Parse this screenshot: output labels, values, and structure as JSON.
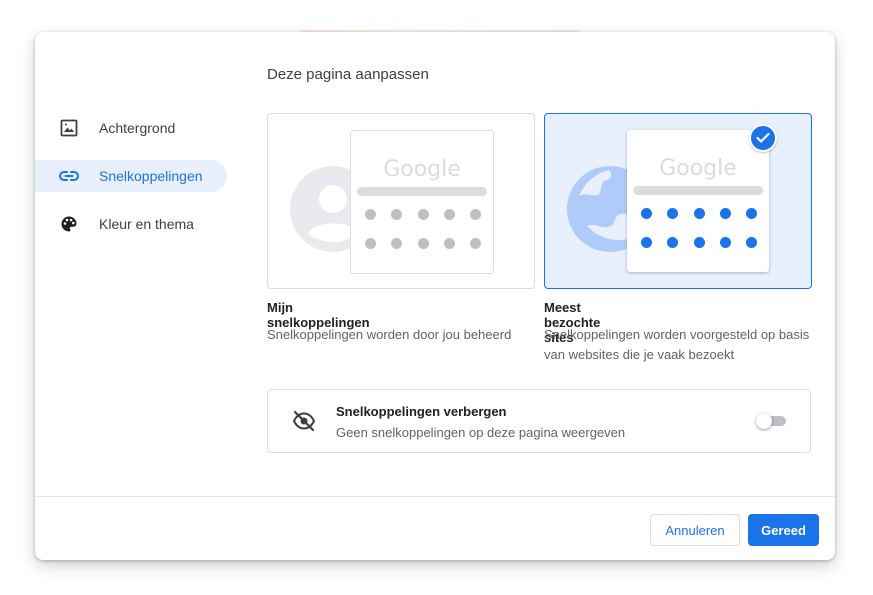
{
  "dialog": {
    "title": "Deze pagina aanpassen"
  },
  "sidebar": {
    "items": [
      {
        "label": "Achtergrond",
        "icon": "image-icon",
        "active": false
      },
      {
        "label": "Snelkoppelingen",
        "icon": "link-icon",
        "active": true
      },
      {
        "label": "Kleur en thema",
        "icon": "palette-icon",
        "active": false
      }
    ]
  },
  "options": [
    {
      "title": "Mijn snelkoppelingen",
      "description": "Snelkoppelingen worden door jou beheerd",
      "logo_text": "Google",
      "selected": false
    },
    {
      "title": "Meest bezochte sites",
      "description": "Snelkoppelingen worden voorgesteld op basis van websites die je vaak bezoekt",
      "logo_text": "Google",
      "selected": true
    }
  ],
  "hide_shortcuts": {
    "title": "Snelkoppelingen verbergen",
    "description": "Geen snelkoppelingen op deze pagina weergeven",
    "icon": "eye-off-icon",
    "enabled": false
  },
  "footer": {
    "cancel_label": "Annuleren",
    "done_label": "Gereed"
  },
  "colors": {
    "accent": "#1a73e8",
    "selected_bg": "#e8f0fe",
    "border": "#dadce0"
  }
}
